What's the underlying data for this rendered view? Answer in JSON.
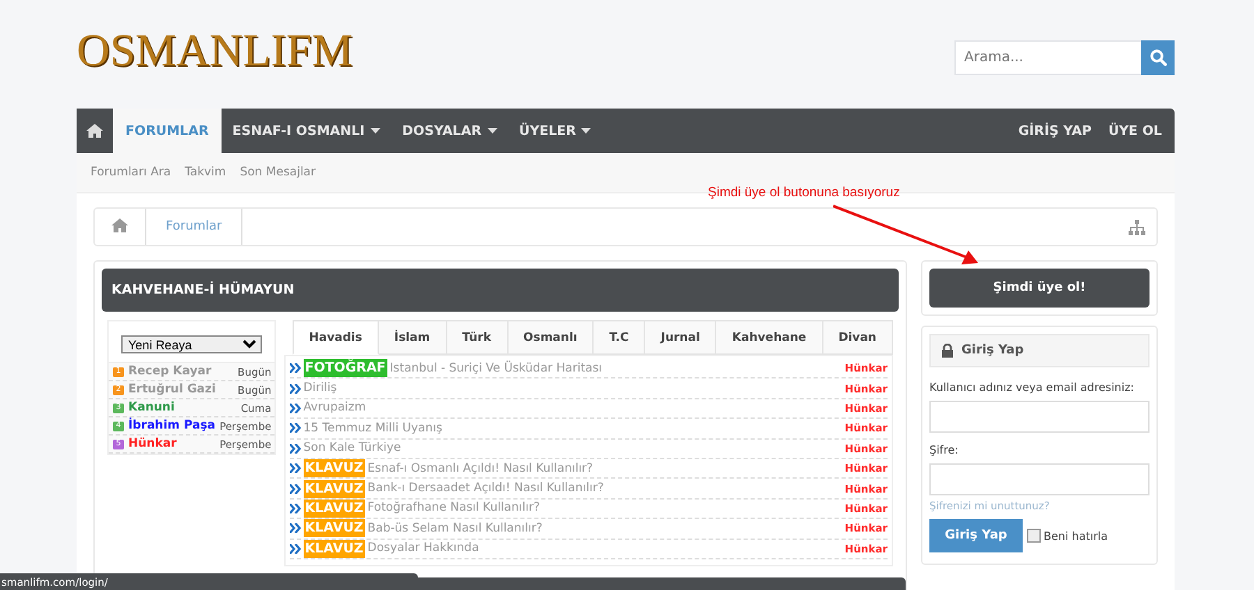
{
  "logo": "OSMANLIFM",
  "search": {
    "placeholder": "Arama..."
  },
  "nav": {
    "items": [
      {
        "label": "FORUMLAR",
        "selected": true,
        "dropdown": false
      },
      {
        "label": "ESNAF-I OSMANLI",
        "selected": false,
        "dropdown": true
      },
      {
        "label": "DOSYALAR",
        "selected": false,
        "dropdown": true
      },
      {
        "label": "ÜYELER",
        "selected": false,
        "dropdown": true
      }
    ],
    "right": [
      "GİRİŞ YAP",
      "ÜYE OL"
    ]
  },
  "subnav": [
    "Forumları Ara",
    "Takvim",
    "Son Mesajlar"
  ],
  "breadcrumb": [
    "Forumlar"
  ],
  "annotation": "Şimdi üye ol butonuna basıyoruz",
  "category": {
    "title": "KAHVEHANE-İ HÜMAYUN"
  },
  "members": {
    "select": "Yeni Reaya",
    "rows": [
      {
        "badge": {
          "text": "1",
          "color": "#f7941d"
        },
        "name": "Recep Kayar",
        "when": "Bugün",
        "color": "#999999"
      },
      {
        "badge": {
          "text": "2",
          "color": "#f7941d"
        },
        "name": "Ertuğrul Gazi",
        "when": "Bugün",
        "color": "#999999"
      },
      {
        "badge": {
          "text": "3",
          "color": "#5cb85c"
        },
        "name": "Kanuni",
        "when": "Cuma",
        "color": "#2e9a4a"
      },
      {
        "badge": {
          "text": "4",
          "color": "#5cb85c"
        },
        "name": "İbrahim Paşa",
        "when": "Perşembe",
        "color": "#1a1aff"
      },
      {
        "badge": {
          "text": "5",
          "color": "#b266d9"
        },
        "name": "Hünkar",
        "when": "Perşembe",
        "color": "#ff2222"
      }
    ]
  },
  "tabs": [
    {
      "label": "Havadis",
      "selected": true
    },
    {
      "label": "İslam",
      "selected": false
    },
    {
      "label": "Türk",
      "selected": false
    },
    {
      "label": "Osmanlı",
      "selected": false
    },
    {
      "label": "T.C",
      "selected": false
    },
    {
      "label": "Jurnal",
      "selected": false
    },
    {
      "label": "Kahvehane",
      "selected": false
    },
    {
      "label": "Divan",
      "selected": false
    }
  ],
  "threads": [
    {
      "prefix": {
        "text": "FOTOĞRAF",
        "color": "#2ebd2e"
      },
      "title": "Istanbul - Suriçi Ve Üsküdar Haritası",
      "author": "Hünkar"
    },
    {
      "title": "Diriliş",
      "author": "Hünkar"
    },
    {
      "title": "Avrupaizm",
      "author": "Hünkar"
    },
    {
      "title": "15 Temmuz Milli Uyanış",
      "author": "Hünkar"
    },
    {
      "title": "Son Kale Türkiye",
      "author": "Hünkar"
    },
    {
      "prefix": {
        "text": "KLAVUZ",
        "color": "#ffa500"
      },
      "title": "Esnaf-ı Osmanlı Açıldı! Nasıl Kullanılır?",
      "author": "Hünkar"
    },
    {
      "prefix": {
        "text": "KLAVUZ",
        "color": "#ffa500"
      },
      "title": "Bank-ı Dersaadet Açıldı! Nasıl Kullanılır?",
      "author": "Hünkar"
    },
    {
      "prefix": {
        "text": "KLAVUZ",
        "color": "#ffa500"
      },
      "title": "Fotoğrafhane Nasıl Kullanılır?",
      "author": "Hünkar"
    },
    {
      "prefix": {
        "text": "KLAVUZ",
        "color": "#ffa500"
      },
      "title": "Bab-üs Selam Nasıl Kullanılır?",
      "author": "Hünkar"
    },
    {
      "prefix": {
        "text": "KLAVUZ",
        "color": "#ffa500"
      },
      "title": "Dosyalar Hakkında",
      "author": "Hünkar"
    }
  ],
  "signup_button": "Şimdi üye ol!",
  "login": {
    "title": "Giriş Yap",
    "user_label": "Kullanıcı adınız veya email adresiniz:",
    "password_label": "Şifre:",
    "forgot": "Şifrenizi mi unuttunuz?",
    "button": "Giriş Yap",
    "remember": {
      "label": "Beni hatırla",
      "checked": false
    }
  },
  "status_bar": "smanlifm.com/login/"
}
